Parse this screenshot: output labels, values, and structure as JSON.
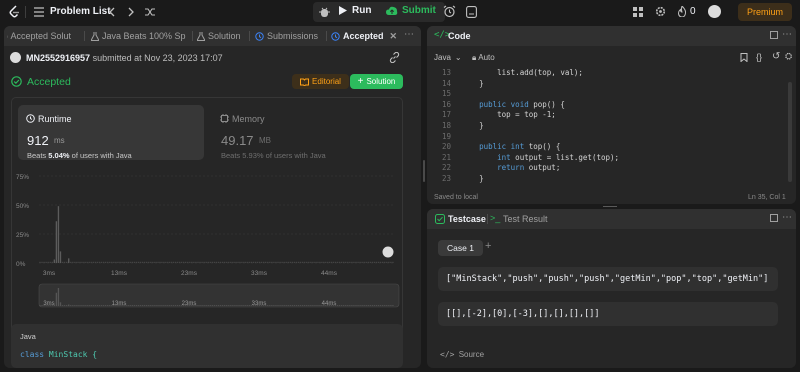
{
  "topbar": {
    "title": "Problem List",
    "run_label": "Run",
    "submit_label": "Submit",
    "streak": "0",
    "premium": "Premium"
  },
  "left_tabs": [
    "Accepted Solut",
    "Java Beats 100% Sp",
    "Solution",
    "Submissions",
    "Accepted"
  ],
  "submission": {
    "user": "MN2552916957",
    "submitted_text": "submitted at Nov 23, 2023 17:07",
    "status": "Accepted",
    "editorial": "Editorial",
    "solution": "Solution"
  },
  "runtime": {
    "label": "Runtime",
    "value": "912",
    "unit": "ms",
    "beats_prefix": "Beats",
    "beats": "5.04%",
    "beats_suffix": "of users with Java"
  },
  "memory": {
    "label": "Memory",
    "value": "49.17",
    "unit": "MB",
    "beats_prefix": "Beats",
    "beats": "5.93%",
    "beats_suffix": "of users with Java"
  },
  "chart_data": {
    "type": "bar",
    "ytick_labels": [
      "75%",
      "50%",
      "25%",
      "0%"
    ],
    "yticks": [
      75,
      50,
      25,
      0
    ],
    "ylim": [
      0,
      75
    ],
    "xtick_labels": [
      "3ms",
      "13ms",
      "23ms",
      "33ms",
      "44ms"
    ],
    "values": [
      0,
      0,
      0,
      0,
      0,
      0,
      0,
      3,
      36,
      49,
      10,
      0,
      0,
      0,
      4,
      0,
      0,
      0,
      0,
      0,
      0,
      0,
      0,
      0,
      0,
      0,
      0,
      0,
      0,
      0,
      0,
      0,
      0,
      0,
      0,
      0,
      0,
      0,
      0,
      0,
      0,
      0,
      0,
      0,
      0,
      0,
      0,
      0,
      0,
      0,
      0,
      0,
      0,
      0,
      0,
      0,
      0,
      0,
      0,
      0,
      0,
      0,
      0,
      0,
      0,
      0,
      0,
      0,
      0,
      0,
      0,
      0,
      0,
      0,
      0,
      0,
      0,
      0,
      0,
      0,
      0,
      0,
      0,
      0,
      0,
      0,
      0,
      0,
      0,
      0,
      0,
      0,
      0,
      0,
      0,
      0,
      0,
      0,
      0,
      0,
      0,
      0,
      0,
      0,
      0,
      0,
      0,
      0,
      0,
      0,
      0,
      0,
      0,
      0,
      0,
      0,
      0,
      0,
      0,
      0,
      0,
      0,
      0,
      0,
      0,
      0,
      0,
      0,
      0,
      0,
      0,
      0,
      0,
      0,
      0,
      0,
      0,
      0,
      0,
      0,
      0,
      0,
      0,
      0,
      0,
      0,
      0,
      0,
      0,
      0,
      0,
      0,
      0,
      0,
      0,
      0,
      0,
      0,
      0,
      0,
      0,
      0,
      0,
      0,
      0,
      0,
      0,
      0,
      0,
      0,
      0,
      0,
      0
    ]
  },
  "java_box": {
    "lang": "Java",
    "code_kw": "class",
    "code_name": "MinStack {"
  },
  "code": {
    "title": "Code",
    "lang": "Java",
    "mode": "Auto",
    "status": "Saved to local",
    "position": "Ln 35, Col 1",
    "line_numbers": [
      "13",
      "14",
      "15",
      "16",
      "17",
      "18",
      "19",
      "20",
      "21",
      "22",
      "23"
    ],
    "lines": [
      {
        "indent": "        ",
        "kw": "",
        "text": "list.add(top, val);"
      },
      {
        "indent": "    ",
        "kw": "",
        "text": "}"
      },
      {
        "indent": "",
        "kw": "",
        "text": ""
      },
      {
        "indent": "    ",
        "kw": "public void",
        "text": " pop() {"
      },
      {
        "indent": "        ",
        "kw": "",
        "text": "top = top -1;"
      },
      {
        "indent": "    ",
        "kw": "",
        "text": "}"
      },
      {
        "indent": "",
        "kw": "",
        "text": ""
      },
      {
        "indent": "    ",
        "kw": "public int",
        "text": " top() {"
      },
      {
        "indent": "        ",
        "kw": "int",
        "text": " output = list.get(top);"
      },
      {
        "indent": "        ",
        "kw": "return",
        "text": " output;"
      },
      {
        "indent": "    ",
        "kw": "",
        "text": "}"
      }
    ]
  },
  "testcase": {
    "tab_label": "Testcase",
    "result_label": "Test Result",
    "case_label": "Case 1",
    "line1": "[\"MinStack\",\"push\",\"push\",\"push\",\"getMin\",\"pop\",\"top\",\"getMin\"]",
    "line2": "[[],[-2],[0],[-3],[],[],[],[]]",
    "source": "Source"
  },
  "colors": {
    "accent": "#ffa116",
    "green": "#2cbb5d",
    "panel": "#262626",
    "bg": "#1a1a1a"
  }
}
